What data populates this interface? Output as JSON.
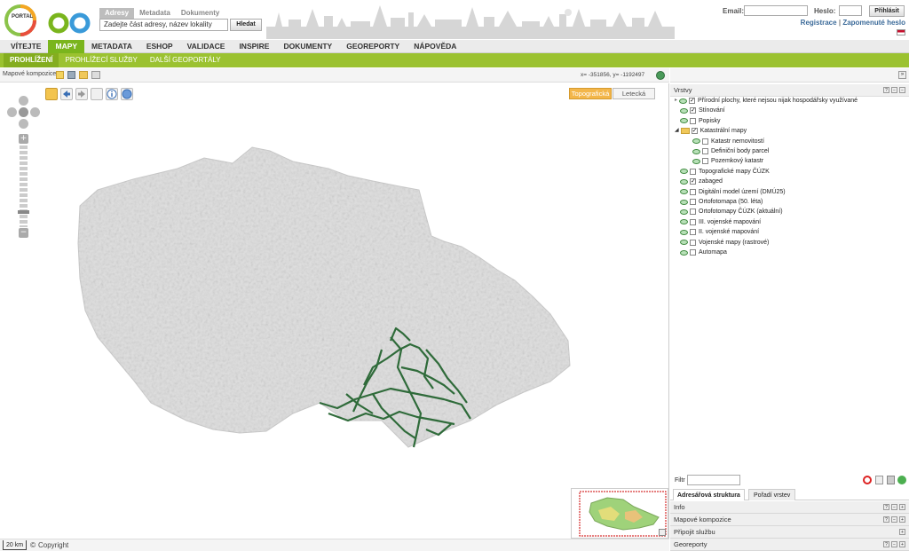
{
  "header": {
    "logo_small": "PORTAL",
    "logo_big": "Geo",
    "search_tabs": [
      {
        "label": "Adresy"
      },
      {
        "label": "Metadata"
      },
      {
        "label": "Dokumenty"
      }
    ],
    "search_placeholder": "Zadejte část adresy, název lokality",
    "search_button": "Hledat",
    "email_label": "Email:",
    "password_label": "Heslo:",
    "login_button": "Přihlásit",
    "register_link": "Registrace",
    "separator": "|",
    "forgot_link": "Zapomenuté heslo"
  },
  "nav": {
    "items": [
      {
        "label": "VÍTEJTE"
      },
      {
        "label": "MAPY"
      },
      {
        "label": "METADATA"
      },
      {
        "label": "ESHOP"
      },
      {
        "label": "VALIDACE"
      },
      {
        "label": "INSPIRE"
      },
      {
        "label": "DOKUMENTY"
      },
      {
        "label": "GEOREPORTY"
      },
      {
        "label": "NÁPOVĚDA"
      }
    ]
  },
  "subnav": {
    "items": [
      {
        "label": "PROHLÍŽENÍ"
      },
      {
        "label": "PROHLÍŽECÍ SLUŽBY"
      },
      {
        "label": "DALŠÍ GEOPORTÁLY"
      }
    ]
  },
  "mapbar": {
    "compositions_label": "Mapové kompozice:",
    "coords": "x= -351856, y= -1192497"
  },
  "map": {
    "base_topo": "Topografická",
    "base_aerial": "Letecká",
    "scale": "20 km",
    "copyright": "Copyright"
  },
  "panel": {
    "title": "Vrstvy",
    "layers": [
      {
        "label": "Přírodní plochy, které nejsou nijak hospodářsky využívané",
        "checked": true,
        "indent": 0
      },
      {
        "label": "Stínování",
        "checked": true,
        "indent": 0
      },
      {
        "label": "Popisky",
        "checked": false,
        "indent": 0
      },
      {
        "label": "Katastrální mapy",
        "checked": true,
        "indent": 0,
        "folder": true
      },
      {
        "label": "Katastr nemovitostí",
        "checked": false,
        "indent": 1
      },
      {
        "label": "Definiční body parcel",
        "checked": false,
        "indent": 1
      },
      {
        "label": "Pozemkový katastr",
        "checked": false,
        "indent": 1
      },
      {
        "label": "Topografické mapy ČÚZK",
        "checked": false,
        "indent": 0
      },
      {
        "label": "zabaged",
        "checked": true,
        "indent": 0
      },
      {
        "label": "Digitální model území (DMÚ25)",
        "checked": false,
        "indent": 0
      },
      {
        "label": "Ortofotomapa (50. léta)",
        "checked": false,
        "indent": 0
      },
      {
        "label": "Ortofotomapy ČÚZK (aktuální)",
        "checked": false,
        "indent": 0
      },
      {
        "label": "III. vojenské mapování",
        "checked": false,
        "indent": 0
      },
      {
        "label": "II. vojenské mapování",
        "checked": false,
        "indent": 0
      },
      {
        "label": "Vojenské mapy (rastrové)",
        "checked": false,
        "indent": 0
      },
      {
        "label": "Automapa",
        "checked": false,
        "indent": 0
      }
    ],
    "filter_label": "Filtr",
    "tabs": [
      {
        "label": "Adresářová struktura"
      },
      {
        "label": "Pořadí vrstev"
      }
    ],
    "sections": [
      {
        "label": "Info"
      },
      {
        "label": "Mapové kompozice"
      },
      {
        "label": "Připojit službu"
      },
      {
        "label": "Georeporty"
      }
    ]
  },
  "colors": {
    "green": "#7ab51d",
    "subgreen": "#9bc230",
    "road": "#2f6b3a",
    "accent_orange": "#f3b64a"
  }
}
